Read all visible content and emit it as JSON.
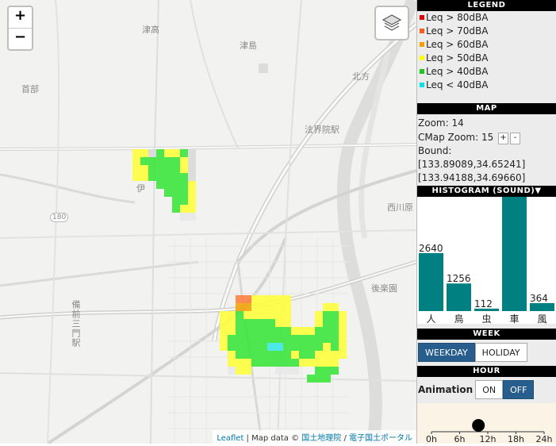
{
  "map": {
    "zoom_in": "+",
    "zoom_out": "−",
    "attribution": {
      "leaflet": "Leaflet",
      "sep1": " | Map data © ",
      "gsi": "国土地理院",
      "sep2": " / ",
      "portal": "電子国土ポータル"
    },
    "labels": {
      "tsutaka": "津高",
      "tsushima": "津島",
      "kitagata": "北方",
      "kubu": "首部",
      "hokanekita": "法界院駅",
      "nishikawara": "西川原",
      "korakuen": "後楽園",
      "ibuki": "伊",
      "route": "180",
      "bizen": "備前三門駅"
    }
  },
  "legend": {
    "title": "LEGEND",
    "items": [
      {
        "label": "Leq > 80dBA",
        "color": "#e60000"
      },
      {
        "label": "Leq > 70dBA",
        "color": "#ff5a1e"
      },
      {
        "label": "Leq > 60dBA",
        "color": "#f5a000"
      },
      {
        "label": "Leq > 50dBA",
        "color": "#ffff00"
      },
      {
        "label": "Leq > 40dBA",
        "color": "#19c819"
      },
      {
        "label": "Leq < 40dBA",
        "color": "#00e6e6"
      }
    ]
  },
  "info": {
    "title": "MAP",
    "zoom": "Zoom: 14",
    "cmap_zoom": "CMap Zoom: 15",
    "plus": "+",
    "minus": "-",
    "bound_label": "Bound:",
    "bound1": "[133.89089,34.65241]",
    "bound2": "[133.94188,34.69660]"
  },
  "histogram_title": "HISTOGRAM (SOUND)▼",
  "chart_data": {
    "type": "bar",
    "categories": [
      "人",
      "鳥",
      "虫",
      "車",
      "風"
    ],
    "values": [
      2640,
      1256,
      112,
      5200,
      364
    ],
    "value_labels": [
      "2640",
      "1256",
      "112",
      "",
      "364"
    ],
    "color": "#008080"
  },
  "week": {
    "title": "WEEK",
    "weekday": "WEEKDAY",
    "holiday": "HOLIDAY",
    "selected": "weekday"
  },
  "hour": {
    "title": "HOUR",
    "animation_label": "Animation",
    "on": "ON",
    "off": "OFF",
    "animation_selected": "off",
    "ticks": [
      "0h",
      "6h",
      "12h",
      "18h",
      "24h"
    ],
    "value_hours": 10
  },
  "colors": {
    "accent": "#285e8e",
    "header": "#000000",
    "bar": "#008080"
  }
}
